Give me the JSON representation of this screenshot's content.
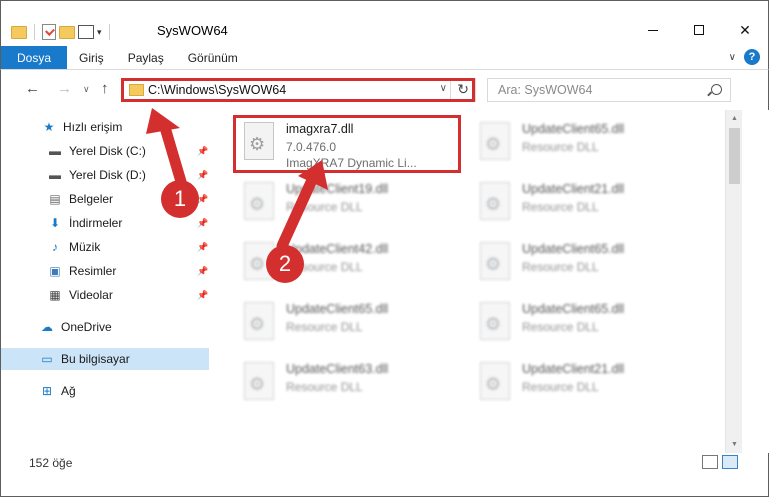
{
  "window": {
    "title": "SysWOW64",
    "minimize_glyph": "",
    "maximize_glyph": "",
    "close_glyph": "✕"
  },
  "ribbon": {
    "tabs": [
      "Dosya",
      "Giriş",
      "Paylaş",
      "Görünüm"
    ],
    "accent_color": "#1979ca",
    "help_glyph": "?",
    "collapse_glyph": "∨"
  },
  "address": {
    "path": "C:\\Windows\\SysWOW64",
    "dropdown_glyph": "∨",
    "refresh_glyph": "↻"
  },
  "search": {
    "placeholder": "Ara: SysWOW64"
  },
  "nav": {
    "back_glyph": "←",
    "forward_glyph": "→",
    "recent_glyph": "∨",
    "up_glyph": "↑"
  },
  "sidebar": {
    "items": [
      {
        "label": "Hızlı erişim",
        "icon": "star-icon",
        "pinned": false,
        "selected": false
      },
      {
        "label": "Yerel Disk (C:)",
        "icon": "drive-icon",
        "pinned": true,
        "selected": false
      },
      {
        "label": "Yerel Disk (D:)",
        "icon": "drive-icon",
        "pinned": true,
        "selected": false
      },
      {
        "label": "Belgeler",
        "icon": "documents-icon",
        "pinned": true,
        "selected": false
      },
      {
        "label": "İndirmeler",
        "icon": "download-icon",
        "pinned": true,
        "selected": false
      },
      {
        "label": "Müzik",
        "icon": "music-icon",
        "pinned": true,
        "selected": false
      },
      {
        "label": "Resimler",
        "icon": "pictures-icon",
        "pinned": true,
        "selected": false
      },
      {
        "label": "Videolar",
        "icon": "videos-icon",
        "pinned": true,
        "selected": false
      },
      {
        "label": "OneDrive",
        "icon": "cloud-icon",
        "pinned": false,
        "selected": false
      },
      {
        "label": "Bu bilgisayar",
        "icon": "computer-icon",
        "pinned": false,
        "selected": true
      },
      {
        "label": "Ağ",
        "icon": "network-icon",
        "pinned": false,
        "selected": false
      }
    ]
  },
  "files": {
    "highlighted": {
      "name": "imagxra7.dll",
      "version": "7.0.476.0",
      "description": "ImagXRA7 Dynamic Li..."
    },
    "blurred": [
      {
        "name": "UpdateClient65.dll",
        "type": "Resource DLL"
      },
      {
        "name": "UpdateClient19.dll",
        "type": "Resource DLL"
      },
      {
        "name": "UpdateClient21.dll",
        "type": "Resource DLL"
      },
      {
        "name": "UpdateClient42.dll",
        "type": "Resource DLL"
      },
      {
        "name": "UpdateClient65.dll",
        "type": "Resource DLL"
      },
      {
        "name": "UpdateClient65.dll",
        "type": "Resource DLL"
      },
      {
        "name": "UpdateClient65.dll",
        "type": "Resource DLL"
      },
      {
        "name": "UpdateClient63.dll",
        "type": "Resource DLL"
      },
      {
        "name": "UpdateClient21.dll",
        "type": "Resource DLL"
      }
    ]
  },
  "status": {
    "item_count": "152 öğe"
  },
  "annotations": {
    "badge_1": "1",
    "badge_2": "2",
    "highlight_color": "#d32f2f"
  }
}
